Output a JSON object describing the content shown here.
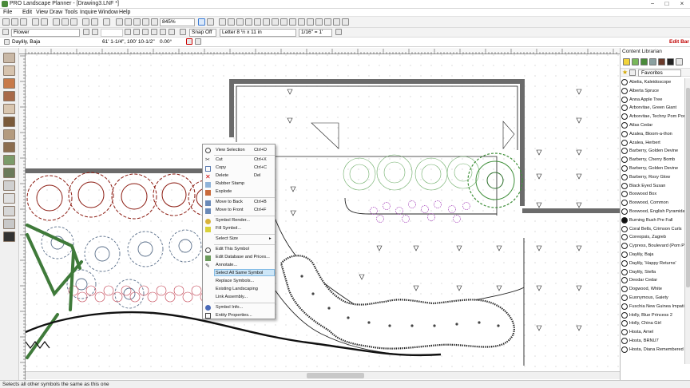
{
  "window": {
    "title": "PRO Landscape Planner - [Drawing3.LNF *]",
    "controls": [
      "−",
      "□",
      "×"
    ]
  },
  "menu": [
    "File",
    "Edit",
    "View",
    "Draw",
    "Tools",
    "Inquire",
    "Window",
    "Help"
  ],
  "toolbar": {
    "zoom": "845%"
  },
  "toolbar2": {
    "layer": "Flower",
    "snap": "Snap Off",
    "page_size": "Letter 8 ½ x 11 in",
    "scale": "1/16\" = 1'"
  },
  "editbar": {
    "symbol": "Daylily, Baja",
    "coords": "61' 1-1/4\", 100' 10-1/2\"",
    "angle": "0.00°",
    "label": "Edit Bar"
  },
  "panel": {
    "title": "Content Librarian",
    "favorites": "Favorites",
    "items": [
      {
        "name": "Abelia, Kaleidoscope",
        "filled": false
      },
      {
        "name": "Alberta Spruce",
        "filled": false
      },
      {
        "name": "Anna Apple Tree",
        "filled": false
      },
      {
        "name": "Arborvitae, Green Giant",
        "filled": false
      },
      {
        "name": "Arborvitae, Techny Pom Pom",
        "filled": false
      },
      {
        "name": "Atlas Cedar",
        "filled": false
      },
      {
        "name": "Azalea, Bloom-a-thon",
        "filled": false
      },
      {
        "name": "Azalea, Herbert",
        "filled": false
      },
      {
        "name": "Barberry, Golden Devine",
        "filled": false
      },
      {
        "name": "Barberry, Cherry Bomb",
        "filled": false
      },
      {
        "name": "Barberry, Golden Devine",
        "filled": false
      },
      {
        "name": "Barberry, Rosy Glow",
        "filled": false
      },
      {
        "name": "Black Eyed Susan",
        "filled": false
      },
      {
        "name": "Boxwood Box",
        "filled": false
      },
      {
        "name": "Boxwood, Common",
        "filled": false
      },
      {
        "name": "Boxwood, English Pyramidal",
        "filled": false
      },
      {
        "name": "Burning Bush Pre Fall",
        "filled": true
      },
      {
        "name": "Coral Bells, Crimson Curls",
        "filled": false
      },
      {
        "name": "Coreopsis, Zagreb",
        "filled": false
      },
      {
        "name": "Cypress, Boulevard (Pom Pon",
        "filled": false
      },
      {
        "name": "Daylily, Baja",
        "filled": false
      },
      {
        "name": "Daylily, 'Happy Returns'",
        "filled": false
      },
      {
        "name": "Daylily, Stella",
        "filled": false
      },
      {
        "name": "Deodar Cedar",
        "filled": false
      },
      {
        "name": "Dogwood, White",
        "filled": false
      },
      {
        "name": "Euonymous, Gaiety",
        "filled": false
      },
      {
        "name": "Fuschia New Guinea Impatien",
        "filled": false
      },
      {
        "name": "Holly, Blue Princess 2",
        "filled": false
      },
      {
        "name": "Holly, China Girl",
        "filled": false
      },
      {
        "name": "Hosta, Amel",
        "filled": false
      },
      {
        "name": "Hosta, BRNU7",
        "filled": false
      },
      {
        "name": "Hosta, Diana Remembered",
        "filled": false
      }
    ]
  },
  "context_menu": {
    "items": [
      {
        "label": "View Selection",
        "shortcut": "Ctrl+D"
      },
      {
        "label": "Cut",
        "shortcut": "Ctrl+X"
      },
      {
        "label": "Copy",
        "shortcut": "Ctrl+C"
      },
      {
        "label": "Delete",
        "shortcut": "Del"
      },
      {
        "label": "Rubber Stamp",
        "shortcut": ""
      },
      {
        "label": "Explode",
        "shortcut": ""
      },
      {
        "label": "Move to Back",
        "shortcut": "Ctrl+B"
      },
      {
        "label": "Move to Front",
        "shortcut": "Ctrl+F"
      },
      {
        "label": "Symbol Render...",
        "shortcut": ""
      },
      {
        "label": "Fill Symbol...",
        "shortcut": ""
      },
      {
        "label": "Select Size",
        "shortcut": "▸"
      },
      {
        "label": "Edit This Symbol",
        "shortcut": ""
      },
      {
        "label": "Edit Database and Prices...",
        "shortcut": ""
      },
      {
        "label": "Annotate...",
        "shortcut": ""
      },
      {
        "label": "Select All Same Symbol",
        "shortcut": ""
      },
      {
        "label": "Replace Symbols...",
        "shortcut": ""
      },
      {
        "label": "Existing Landscaping",
        "shortcut": ""
      },
      {
        "label": "Link Assembly...",
        "shortcut": ""
      },
      {
        "label": "Symbol Info...",
        "shortcut": ""
      },
      {
        "label": "Entity Properties...",
        "shortcut": ""
      }
    ],
    "highlighted": "Select All Same Symbol"
  },
  "status": "Selects all other symbols the same as this one",
  "colors": {
    "accent": "#c00000",
    "shrub_red": "#8b1a10",
    "shrub_blue": "#5a6f8a",
    "shrub_green": "#3f8f3a",
    "flower_purple": "#a23ab8",
    "wall": "#6b6b6b",
    "highlight": "#cde6f7"
  }
}
